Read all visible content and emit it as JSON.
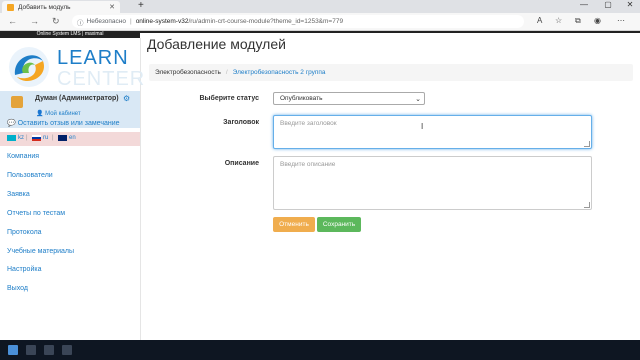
{
  "browser": {
    "tab_title": "Добавить модуль",
    "tab_close": "✕",
    "new_tab": "+",
    "security_label": "Небезопасно",
    "url_host": "online-system-v32",
    "url_path": "/ru/admin-crt-course-module?theme_id=1253&m=779"
  },
  "header": {
    "strip_text": "Online System LMS | maximal"
  },
  "logo": {
    "line1": "LEARN",
    "line2": "CENTER"
  },
  "user": {
    "name": "Думан (Администратор)",
    "cabinet": "Мой кабинет",
    "feedback": "Оставить отзыв или замечание"
  },
  "languages": [
    {
      "code": "kz",
      "color": "#00afca"
    },
    {
      "code": "ru",
      "color": "#d52b1e"
    },
    {
      "code": "en",
      "color": "#012169"
    }
  ],
  "nav": [
    "Компания",
    "Пользователи",
    "Заявка",
    "Отчеты по тестам",
    "Протокола",
    "Учебные материалы",
    "Настройка",
    "Выход"
  ],
  "page": {
    "title": "Добавление модулей",
    "breadcrumb": [
      "Электробезопасность",
      "Электробезопасность 2 группа"
    ]
  },
  "form": {
    "status_label": "Выберите статус",
    "status_value": "Опубликовать",
    "title_label": "Заголовок",
    "title_placeholder": "Введите заголовок",
    "desc_label": "Описание",
    "desc_placeholder": "Введите описание",
    "cancel_label": "Отменить",
    "save_label": "Сохранить"
  },
  "colors": {
    "accent": "#1e7ec8",
    "cancel": "#f0ad4e",
    "save": "#5cb85c"
  }
}
